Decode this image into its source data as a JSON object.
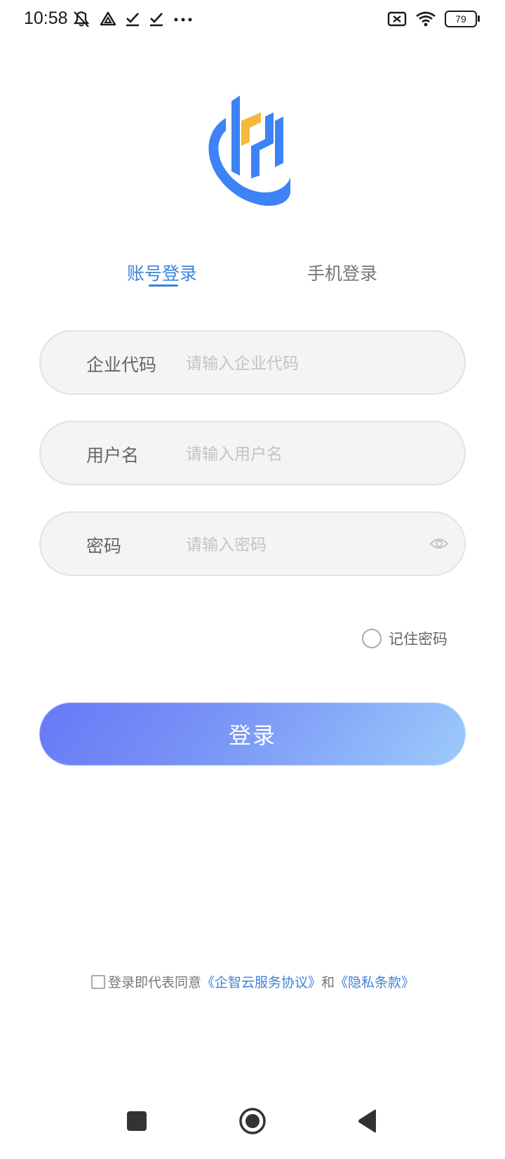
{
  "status_bar": {
    "time": "10:58",
    "battery": "79",
    "icons": [
      "mute-icon",
      "drive-icon",
      "check-icon",
      "check-icon",
      "more-icon",
      "no-sim-icon",
      "wifi-icon",
      "battery-icon"
    ]
  },
  "tabs": {
    "account_login": "账号登录",
    "phone_login": "手机登录",
    "active": "account_login"
  },
  "form": {
    "company_code": {
      "label": "企业代码",
      "placeholder": "请输入企业代码",
      "value": ""
    },
    "username": {
      "label": "用户名",
      "placeholder": "请输入用户名",
      "value": ""
    },
    "password": {
      "label": "密码",
      "placeholder": "请输入密码",
      "value": ""
    },
    "remember_label": "记住密码",
    "login_button": "登录"
  },
  "agreement": {
    "prefix": "登录即代表同意",
    "service_link": "《企智云服务协议》",
    "conjunction": "和",
    "privacy_link": "《隐私条款》"
  },
  "colors": {
    "accent": "#3d82db",
    "logo_blue": "#3d82f6",
    "logo_yellow": "#f6b93b"
  }
}
